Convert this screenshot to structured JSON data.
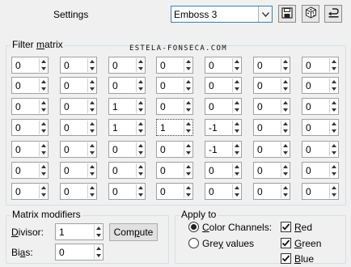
{
  "header": {
    "settings_label": "Settings",
    "preset_value": "Emboss 3",
    "save_icon": "save-icon",
    "random_icon": "dice-icon",
    "reset_icon": "reset-icon"
  },
  "watermark": "ESTELA-FONSECA.COM",
  "filter_matrix": {
    "legend_prefix": "Filter ",
    "legend_key": "m",
    "legend_suffix": "atrix",
    "rows": [
      [
        "0",
        "0",
        "0",
        "0",
        "0",
        "0",
        "0"
      ],
      [
        "0",
        "0",
        "0",
        "0",
        "0",
        "0",
        "0"
      ],
      [
        "0",
        "0",
        "1",
        "0",
        "0",
        "0",
        "0"
      ],
      [
        "0",
        "0",
        "1",
        "1",
        "-1",
        "0",
        "0"
      ],
      [
        "0",
        "0",
        "0",
        "0",
        "-1",
        "0",
        "0"
      ],
      [
        "0",
        "0",
        "0",
        "0",
        "0",
        "0",
        "0"
      ],
      [
        "0",
        "0",
        "0",
        "0",
        "0",
        "0",
        "0"
      ]
    ],
    "focused_cell": "3,3"
  },
  "matrix_modifiers": {
    "legend": "Matrix modifiers",
    "divisor_prefix": "",
    "divisor_key": "D",
    "divisor_suffix": "ivisor:",
    "divisor_value": "1",
    "bias_prefix": "Bi",
    "bias_key": "a",
    "bias_suffix": "s:",
    "bias_value": "0",
    "compute_prefix": "Com",
    "compute_key": "p",
    "compute_suffix": "ute"
  },
  "apply_to": {
    "legend": "Apply to",
    "color_channels_prefix": "",
    "color_channels_key": "C",
    "color_channels_suffix": "olor Channels:",
    "color_channels_selected": true,
    "grey_prefix": "Gre",
    "grey_key": "y",
    "grey_suffix": " values",
    "grey_selected": false,
    "red_key": "R",
    "red_suffix": "ed",
    "green_key": "G",
    "green_suffix": "reen",
    "blue_key": "B",
    "blue_suffix": "lue",
    "red_checked": true,
    "green_checked": true,
    "blue_checked": true
  }
}
